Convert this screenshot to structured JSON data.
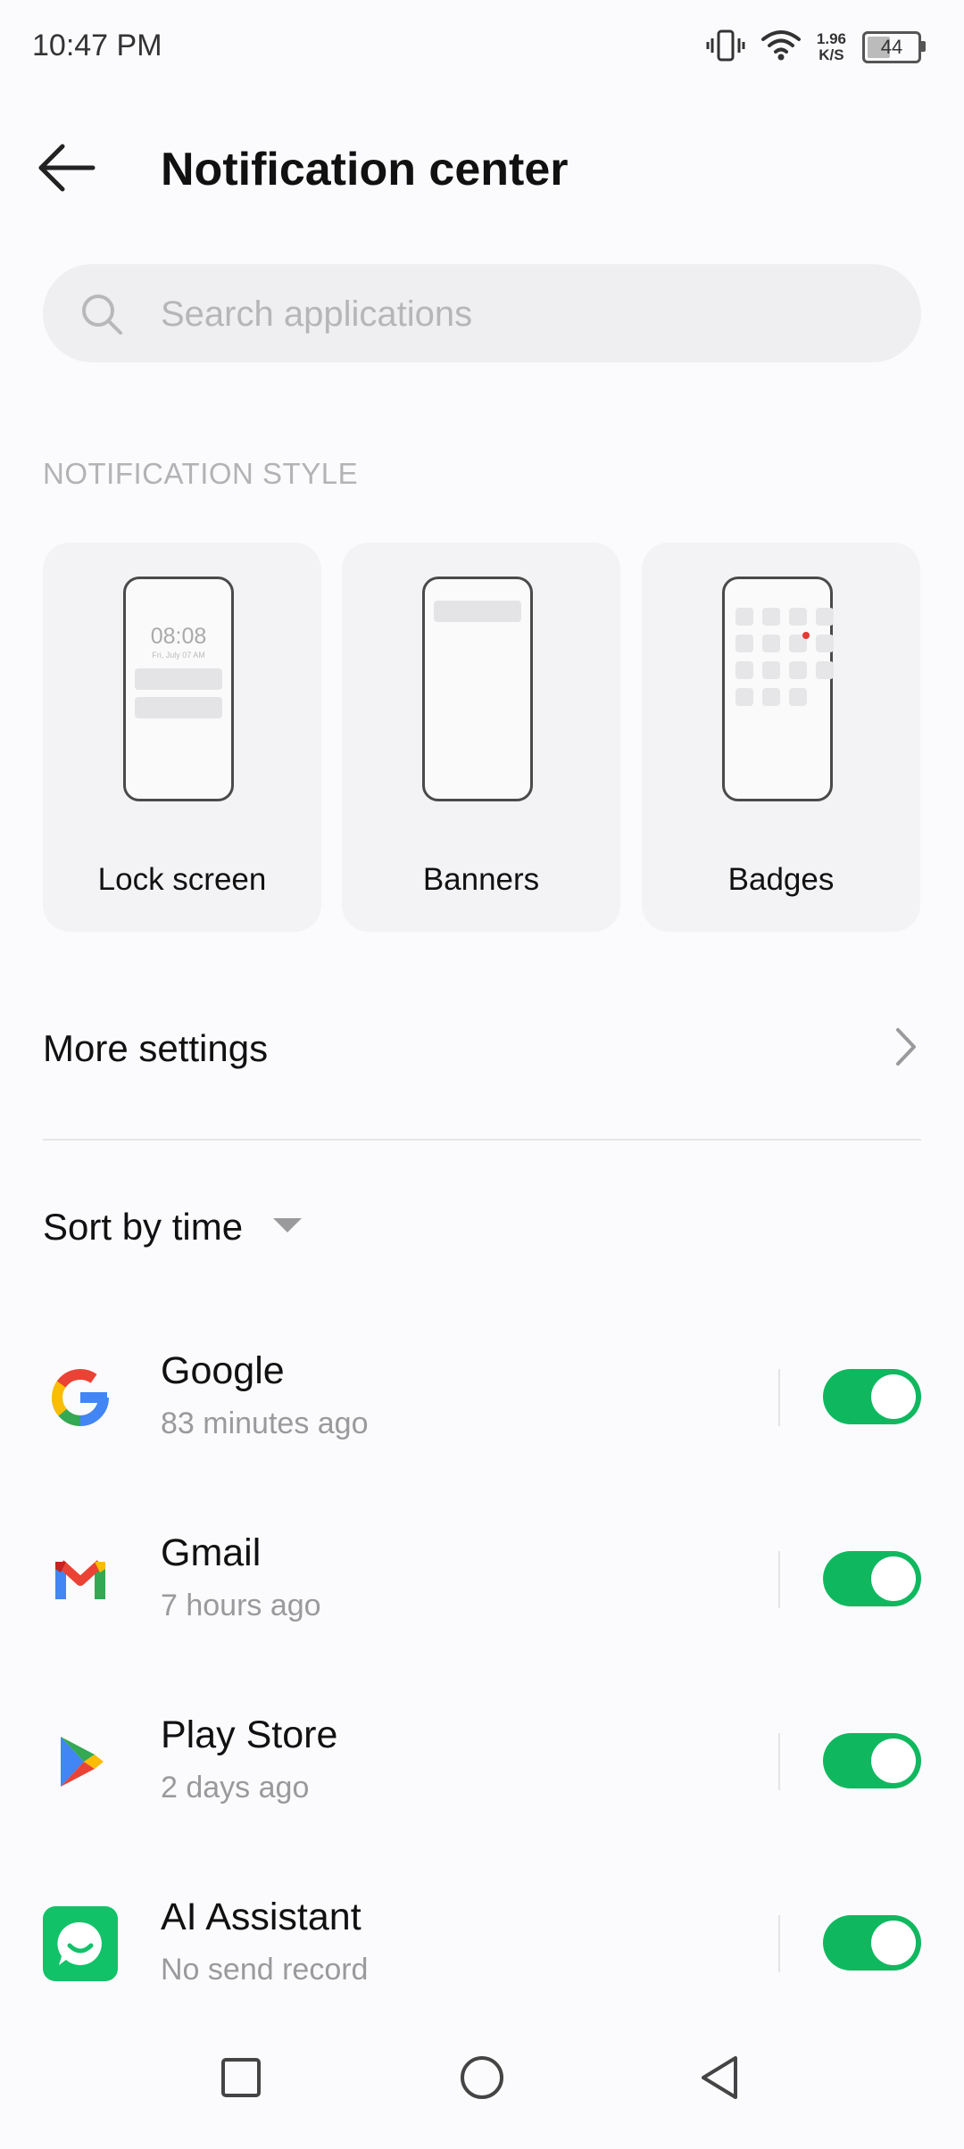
{
  "status_bar": {
    "time": "10:47 PM",
    "net_speed_value": "1.96",
    "net_speed_unit": "K/S",
    "battery": "44",
    "battery_level": 0.44,
    "icons": [
      "vibrate-icon",
      "wifi-icon",
      "battery-icon"
    ]
  },
  "header": {
    "title": "Notification center",
    "back_icon": "arrow-left-icon"
  },
  "search": {
    "placeholder": "Search applications",
    "value": "",
    "icon": "search-icon"
  },
  "notification_style": {
    "section_label": "NOTIFICATION STYLE",
    "cards": [
      {
        "label": "Lock screen",
        "preview_time": "08:08",
        "preview_date": "Fri, July 07 AM"
      },
      {
        "label": "Banners"
      },
      {
        "label": "Badges"
      }
    ]
  },
  "more_settings": {
    "label": "More settings",
    "icon": "chevron-right-icon"
  },
  "sort": {
    "label": "Sort by time",
    "icon": "caret-down-icon"
  },
  "apps": [
    {
      "name": "Google",
      "subtitle": "83 minutes ago",
      "enabled": true,
      "icon": "google-icon"
    },
    {
      "name": "Gmail",
      "subtitle": "7 hours ago",
      "enabled": true,
      "icon": "gmail-icon"
    },
    {
      "name": "Play Store",
      "subtitle": "2 days ago",
      "enabled": true,
      "icon": "play-store-icon"
    },
    {
      "name": "AI Assistant",
      "subtitle": "No send record",
      "enabled": true,
      "icon": "ai-assistant-icon"
    }
  ],
  "colors": {
    "toggle_on": "#0fb85f",
    "background": "#fbfbfd",
    "card_bg": "#f3f3f5"
  },
  "nav_bar": {
    "buttons": [
      "recents-square-icon",
      "home-circle-icon",
      "back-triangle-icon"
    ]
  }
}
